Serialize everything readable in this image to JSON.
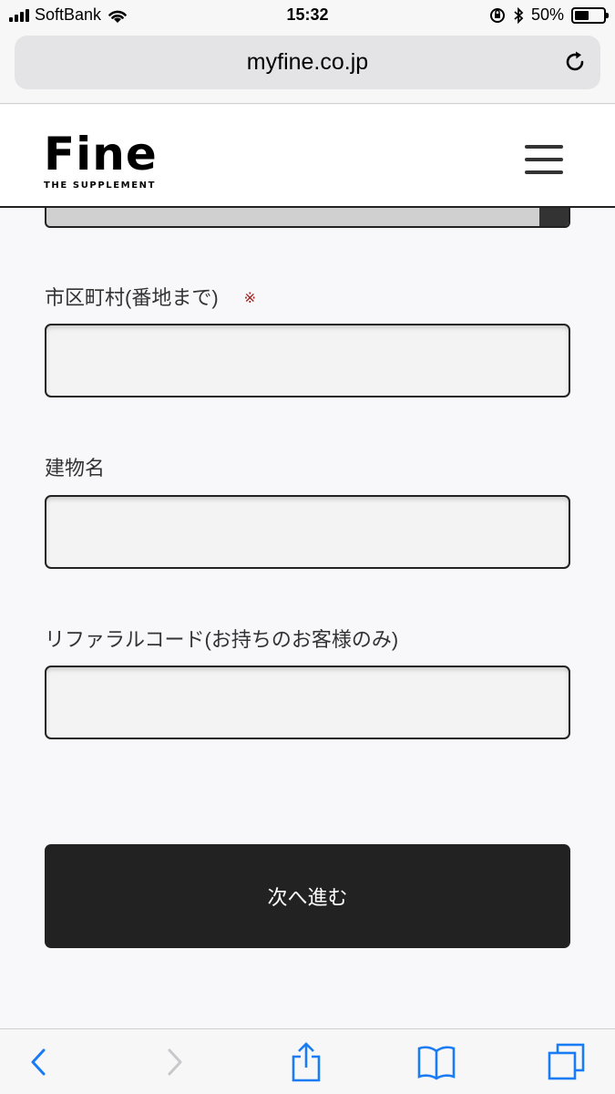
{
  "status_bar": {
    "carrier": "SoftBank",
    "time": "15:32",
    "battery_percent_label": "50%",
    "battery_level": 0.5
  },
  "browser": {
    "url": "myfine.co.jp"
  },
  "site_header": {
    "logo_text": "Fine",
    "logo_tagline": "THE SUPPLEMENT"
  },
  "form": {
    "city_label": "市区町村(番地まで)",
    "required_mark": "※",
    "city_value": "",
    "building_label": "建物名",
    "building_value": "",
    "referral_label": "リファラルコード(お持ちのお客様のみ)",
    "referral_value": "",
    "next_button_label": "次へ進む"
  },
  "colors": {
    "accent_dark": "#222222",
    "ios_blue": "#1a7cf4",
    "required_red": "#a02020"
  },
  "toolbar_icons": [
    "back-icon",
    "forward-icon",
    "share-icon",
    "bookmarks-icon",
    "tabs-icon"
  ]
}
